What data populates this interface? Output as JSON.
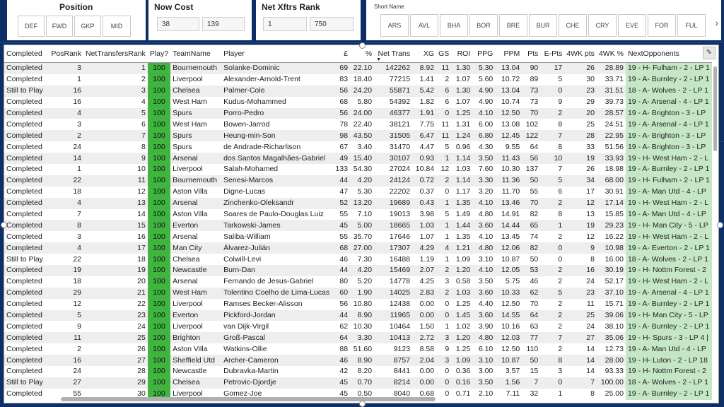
{
  "position_slicer": {
    "title": "Position",
    "options": [
      "DEF",
      "FWD",
      "GKP",
      "MID"
    ]
  },
  "cost_slicer": {
    "title": "Now Cost",
    "min": "38",
    "max": "139"
  },
  "rank_slicer": {
    "title": "Net Xftrs Rank",
    "min": "1",
    "max": "750"
  },
  "team_slicer": {
    "title": "Short Name",
    "options": [
      "ARS",
      "AVL",
      "BHA",
      "BOR",
      "BRE",
      "BUR",
      "CHE",
      "CRY",
      "EVE",
      "FOR",
      "FUL"
    ],
    "next_icon": "chevron-right-icon"
  },
  "table": {
    "headers": [
      "Completed",
      "PosRank",
      "NetTransfersRank",
      "Play?",
      "TeamName",
      "Player",
      "£",
      "%",
      "Net Trans",
      "XG",
      "GS",
      "ROI",
      "PPG",
      "PPM",
      "Pts",
      "E-Pts",
      "4WK pts",
      "4WK %",
      "NextOpponents"
    ],
    "sorted_column": "Net Trans",
    "rows": [
      [
        "Completed",
        "3",
        "1",
        "100",
        "Bournemouth",
        "Solanke-Dominic",
        "69",
        "22.10",
        "142262",
        "8.92",
        "11",
        "1.30",
        "5.30",
        "13.04",
        "90",
        "17",
        "26",
        "28.89",
        "19 - H- Fulham - 2 - LP 1"
      ],
      [
        "Completed",
        "1",
        "2",
        "100",
        "Liverpool",
        "Alexander-Arnold-Trent",
        "83",
        "18.40",
        "77215",
        "1.41",
        "2",
        "1.07",
        "5.60",
        "10.72",
        "89",
        "5",
        "30",
        "33.71",
        "19 - A- Burnley - 2 - LP 1"
      ],
      [
        "Still to Play",
        "16",
        "3",
        "100",
        "Chelsea",
        "Palmer-Cole",
        "56",
        "24.20",
        "55871",
        "5.42",
        "6",
        "1.30",
        "4.90",
        "13.04",
        "73",
        "0",
        "23",
        "31.51",
        "18 - A- Wolves - 2 - LP 1"
      ],
      [
        "Completed",
        "16",
        "4",
        "100",
        "West Ham",
        "Kudus-Mohammed",
        "68",
        "5.80",
        "54392",
        "1.82",
        "6",
        "1.07",
        "4.90",
        "10.74",
        "73",
        "9",
        "29",
        "39.73",
        "19 - A- Arsenal - 4 - LP 1"
      ],
      [
        "Completed",
        "4",
        "5",
        "100",
        "Spurs",
        "Porro-Pedro",
        "56",
        "24.00",
        "46377",
        "1.91",
        "0",
        "1.25",
        "4.10",
        "12.50",
        "70",
        "2",
        "20",
        "28.57",
        "19 - A- Brighton - 3 - LP"
      ],
      [
        "Completed",
        "3",
        "6",
        "100",
        "West Ham",
        "Bowen-Jarrod",
        "78",
        "22.40",
        "38121",
        "7.75",
        "11",
        "1.31",
        "6.00",
        "13.08",
        "102",
        "8",
        "25",
        "24.51",
        "19 - A- Arsenal - 4 - LP 1"
      ],
      [
        "Completed",
        "2",
        "7",
        "100",
        "Spurs",
        "Heung-min-Son",
        "98",
        "43.50",
        "31505",
        "6.47",
        "11",
        "1.24",
        "6.80",
        "12.45",
        "122",
        "7",
        "28",
        "22.95",
        "19 - A- Brighton - 3 - LP"
      ],
      [
        "Completed",
        "24",
        "8",
        "100",
        "Spurs",
        "de Andrade-Richarlison",
        "67",
        "3.40",
        "31470",
        "4.47",
        "5",
        "0.96",
        "4.30",
        "9.55",
        "64",
        "8",
        "33",
        "51.56",
        "19 - A- Brighton - 3 - LP"
      ],
      [
        "Completed",
        "14",
        "9",
        "100",
        "Arsenal",
        "dos Santos Magalhães-Gabriel",
        "49",
        "15.40",
        "30107",
        "0.93",
        "1",
        "1.14",
        "3.50",
        "11.43",
        "56",
        "10",
        "19",
        "33.93",
        "19 - H- West Ham - 2 - L"
      ],
      [
        "Completed",
        "1",
        "10",
        "100",
        "Liverpool",
        "Salah-Mohamed",
        "133",
        "54.30",
        "27024",
        "10.84",
        "12",
        "1.03",
        "7.60",
        "10.30",
        "137",
        "7",
        "26",
        "18.98",
        "19 - A- Burnley - 2 - LP 1"
      ],
      [
        "Completed",
        "22",
        "11",
        "100",
        "Bournemouth",
        "Senesi-Marcos",
        "44",
        "4.20",
        "24124",
        "0.72",
        "2",
        "1.14",
        "3.30",
        "11.36",
        "50",
        "5",
        "34",
        "68.00",
        "19 - H- Fulham - 2 - LP 1"
      ],
      [
        "Completed",
        "18",
        "12",
        "100",
        "Aston Villa",
        "Digne-Lucas",
        "47",
        "5.30",
        "22202",
        "0.37",
        "0",
        "1.17",
        "3.20",
        "11.70",
        "55",
        "6",
        "17",
        "30.91",
        "19 - A- Man Utd - 4 - LP"
      ],
      [
        "Completed",
        "4",
        "13",
        "100",
        "Arsenal",
        "Zinchenko-Oleksandr",
        "52",
        "13.20",
        "19689",
        "0.43",
        "1",
        "1.35",
        "4.10",
        "13.46",
        "70",
        "2",
        "12",
        "17.14",
        "19 - H- West Ham - 2 - L"
      ],
      [
        "Completed",
        "7",
        "14",
        "100",
        "Aston Villa",
        "Soares de Paulo-Douglas Luiz",
        "55",
        "7.10",
        "19013",
        "3.98",
        "5",
        "1.49",
        "4.80",
        "14.91",
        "82",
        "8",
        "13",
        "15.85",
        "19 - A- Man Utd - 4 - LP"
      ],
      [
        "Completed",
        "8",
        "15",
        "100",
        "Everton",
        "Tarkowski-James",
        "45",
        "5.00",
        "18665",
        "1.03",
        "1",
        "1.44",
        "3.60",
        "14.44",
        "65",
        "1",
        "19",
        "29.23",
        "19 - H- Man City - 5 - LP"
      ],
      [
        "Completed",
        "3",
        "16",
        "100",
        "Arsenal",
        "Saliba-William",
        "55",
        "35.70",
        "17646",
        "1.07",
        "1",
        "1.35",
        "4.10",
        "13.45",
        "74",
        "2",
        "12",
        "16.22",
        "19 - H- West Ham - 2 - L"
      ],
      [
        "Completed",
        "4",
        "17",
        "100",
        "Man City",
        "Álvarez-Julián",
        "68",
        "27.00",
        "17307",
        "4.29",
        "4",
        "1.21",
        "4.80",
        "12.06",
        "82",
        "0",
        "9",
        "10.98",
        "19 - A- Everton - 2 - LP 1"
      ],
      [
        "Still to Play",
        "22",
        "18",
        "100",
        "Chelsea",
        "Colwill-Levi",
        "46",
        "7.30",
        "16488",
        "1.19",
        "1",
        "1.09",
        "3.10",
        "10.87",
        "50",
        "0",
        "8",
        "16.00",
        "18 - A- Wolves - 2 - LP 1"
      ],
      [
        "Completed",
        "19",
        "19",
        "100",
        "Newcastle",
        "Burn-Dan",
        "44",
        "4.20",
        "15469",
        "2.07",
        "2",
        "1.20",
        "4.10",
        "12.05",
        "53",
        "2",
        "16",
        "30.19",
        "19 - H- Nottm Forest - 2"
      ],
      [
        "Completed",
        "18",
        "20",
        "100",
        "Arsenal",
        "Fernando de Jesus-Gabriel",
        "80",
        "5.20",
        "14778",
        "4.25",
        "3",
        "0.58",
        "3.50",
        "5.75",
        "46",
        "2",
        "24",
        "52.17",
        "19 - H- West Ham - 2 - L"
      ],
      [
        "Completed",
        "29",
        "21",
        "100",
        "West Ham",
        "Tolentino Coelho de Lima-Lucas",
        "60",
        "1.90",
        "14025",
        "2.83",
        "2",
        "1.03",
        "3.60",
        "10.33",
        "62",
        "5",
        "23",
        "37.10",
        "19 - A- Arsenal - 4 - LP 1"
      ],
      [
        "Completed",
        "12",
        "22",
        "100",
        "Liverpool",
        "Ramses Becker-Alisson",
        "56",
        "10.80",
        "12438",
        "0.00",
        "0",
        "1.25",
        "4.40",
        "12.50",
        "70",
        "2",
        "11",
        "15.71",
        "19 - A- Burnley - 2 - LP 1"
      ],
      [
        "Completed",
        "5",
        "23",
        "100",
        "Everton",
        "Pickford-Jordan",
        "44",
        "8.90",
        "11965",
        "0.00",
        "0",
        "1.45",
        "3.60",
        "14.55",
        "64",
        "2",
        "25",
        "39.06",
        "19 - H- Man City - 5 - LP"
      ],
      [
        "Completed",
        "9",
        "24",
        "100",
        "Liverpool",
        "van Dijk-Virgil",
        "62",
        "10.30",
        "10464",
        "1.50",
        "1",
        "1.02",
        "3.90",
        "10.16",
        "63",
        "2",
        "24",
        "38.10",
        "19 - A- Burnley - 2 - LP 1"
      ],
      [
        "Completed",
        "11",
        "25",
        "100",
        "Brighton",
        "Groß-Pascal",
        "64",
        "3.30",
        "10413",
        "2.72",
        "3",
        "1.20",
        "4.80",
        "12.03",
        "77",
        "7",
        "27",
        "35.06",
        "19 - H- Spurs - 3 - LP 4 |"
      ],
      [
        "Completed",
        "2",
        "26",
        "100",
        "Aston Villa",
        "Watkins-Ollie",
        "88",
        "51.60",
        "9123",
        "8.58",
        "9",
        "1.25",
        "6.10",
        "12.50",
        "110",
        "2",
        "14",
        "12.73",
        "19 - A- Man Utd - 4 - LP"
      ],
      [
        "Completed",
        "16",
        "27",
        "100",
        "Sheffield Utd",
        "Archer-Cameron",
        "46",
        "8.90",
        "8757",
        "2.04",
        "3",
        "1.09",
        "3.10",
        "10.87",
        "50",
        "8",
        "14",
        "28.00",
        "19 - H- Luton - 2 - LP 18"
      ],
      [
        "Completed",
        "24",
        "28",
        "100",
        "Newcastle",
        "Dubravka-Martin",
        "42",
        "8.20",
        "8441",
        "0.00",
        "0",
        "0.36",
        "3.00",
        "3.57",
        "15",
        "3",
        "14",
        "93.33",
        "19 - H- Nottm Forest - 2"
      ],
      [
        "Still to Play",
        "27",
        "29",
        "100",
        "Chelsea",
        "Petrovic-Djordje",
        "45",
        "0.70",
        "8214",
        "0.00",
        "0",
        "0.16",
        "3.50",
        "1.56",
        "7",
        "0",
        "7",
        "100.00",
        "18 - A- Wolves - 2 - LP 1"
      ],
      [
        "Completed",
        "55",
        "30",
        "100",
        "Liverpool",
        "Gomez-Joe",
        "45",
        "0.50",
        "8040",
        "0.68",
        "0",
        "0.71",
        "2.10",
        "7.11",
        "32",
        "1",
        "8",
        "25.00",
        "19 - A- Burnley - 2 - LP 1"
      ]
    ]
  },
  "colors": {
    "background": "#0e2f66",
    "play_cell": "#3fb43f",
    "next_opponent_cell": "#c6e7c6"
  }
}
